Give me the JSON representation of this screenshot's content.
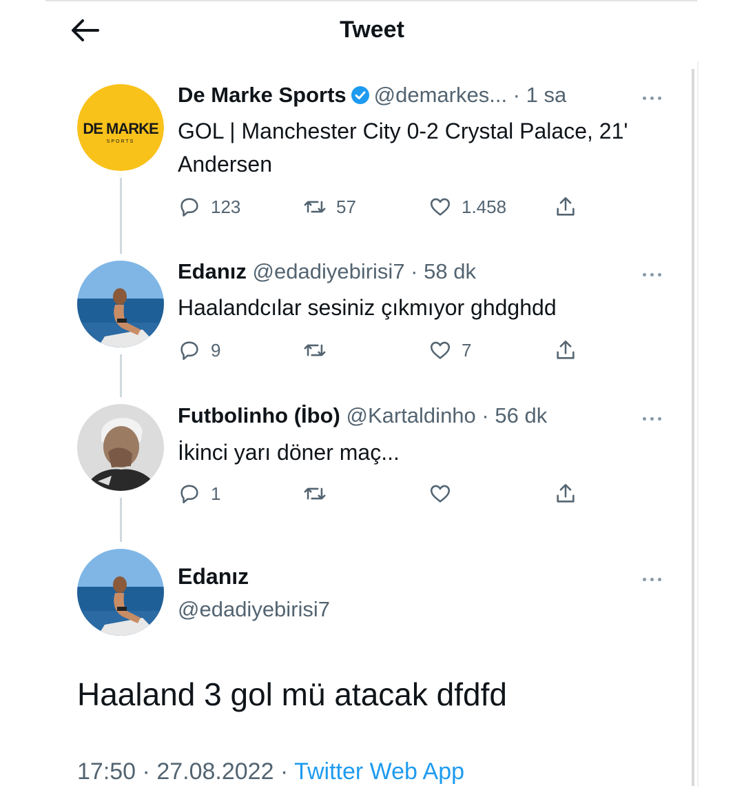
{
  "header": {
    "title": "Tweet",
    "back_icon": "arrow-left-icon"
  },
  "thread": [
    {
      "name": "De Marke Sports",
      "verified": true,
      "handle": "@demarkes...",
      "dot": " · ",
      "time": "1 sa",
      "text": "GOL | Manchester City 0-2 Crystal Palace, 21' Andersen",
      "avatar_logo_text": "DE MARKE",
      "avatar_logo_sub": "SPORTS",
      "replies": "123",
      "retweets": "57",
      "likes": "1.458"
    },
    {
      "name": "Edanız",
      "handle": "@edadiyebirisi7",
      "dot": " · ",
      "time": "58 dk",
      "text": "Haalandcılar sesiniz çıkmıyor ghdghdd",
      "replies": "9",
      "retweets": "",
      "likes": "7"
    },
    {
      "name": "Futbolinho (İbo)",
      "handle": "@Kartaldinho",
      "dot": " · ",
      "time": "56 dk",
      "text": "İkinci yarı döner maç...",
      "replies": "1",
      "retweets": "",
      "likes": ""
    }
  ],
  "main_tweet": {
    "name": "Edanız",
    "handle": "@edadiyebirisi7",
    "text": "Haaland 3 gol mü atacak dfdfd",
    "time": "17:50",
    "sep": " · ",
    "date": "27.08.2022",
    "app": "Twitter Web App"
  },
  "colors": {
    "accent": "#1d9bf0",
    "muted": "#536471",
    "logo_bg": "#f9c21b"
  },
  "icons": [
    "arrow-left-icon",
    "verified-badge-icon",
    "more-icon",
    "reply-icon",
    "retweet-icon",
    "like-icon",
    "share-icon"
  ]
}
